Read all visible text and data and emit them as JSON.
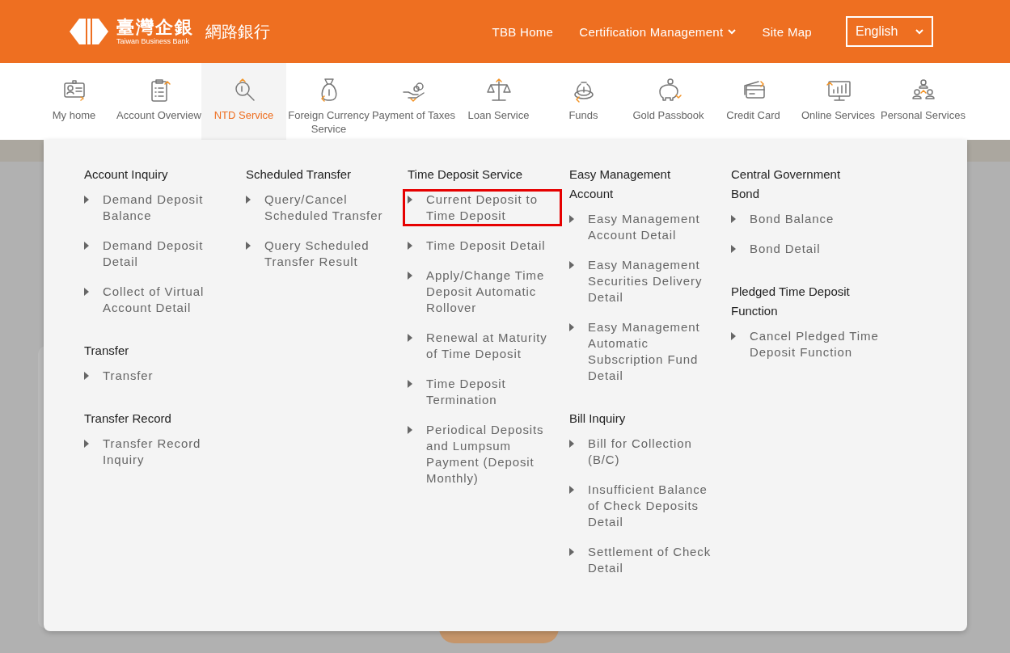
{
  "header": {
    "logo_main": "臺灣企銀",
    "logo_sub": "Taiwan Business Bank",
    "site_title": "網路銀行",
    "links": [
      {
        "label": "TBB Home",
        "dropdown": false
      },
      {
        "label": "Certification Management",
        "dropdown": true
      },
      {
        "label": "Site Map",
        "dropdown": false
      }
    ],
    "language": {
      "value": "English"
    }
  },
  "nav": [
    {
      "label": "My home",
      "selected": false
    },
    {
      "label": "Account Overview",
      "selected": false
    },
    {
      "label": "NTD Service",
      "selected": true
    },
    {
      "label": "Foreign Currency Service",
      "selected": false
    },
    {
      "label": "Payment of Taxes",
      "selected": false
    },
    {
      "label": "Loan Service",
      "selected": false
    },
    {
      "label": "Funds",
      "selected": false
    },
    {
      "label": "Gold Passbook",
      "selected": false
    },
    {
      "label": "Credit Card",
      "selected": false
    },
    {
      "label": "Online Services",
      "selected": false
    },
    {
      "label": "Personal Services",
      "selected": false
    }
  ],
  "menu": {
    "columns": [
      {
        "groups": [
          {
            "title": "Account Inquiry",
            "items": [
              {
                "label": "Demand Deposit Balance",
                "highlighted": false
              },
              {
                "label": "Demand Deposit Detail",
                "highlighted": false
              },
              {
                "label": "Collect of Virtual Account Detail",
                "highlighted": false
              }
            ]
          },
          {
            "title": "Transfer",
            "items": [
              {
                "label": "Transfer",
                "highlighted": false
              }
            ]
          },
          {
            "title": "Transfer Record",
            "items": [
              {
                "label": "Transfer Record Inquiry",
                "highlighted": false
              }
            ]
          }
        ]
      },
      {
        "groups": [
          {
            "title": "Scheduled Transfer",
            "items": [
              {
                "label": "Query/Cancel Scheduled Transfer",
                "highlighted": false
              },
              {
                "label": "Query Scheduled Transfer Result",
                "highlighted": false
              }
            ]
          }
        ]
      },
      {
        "groups": [
          {
            "title": "Time Deposit Service",
            "items": [
              {
                "label": "Current Deposit to Time Deposit",
                "highlighted": true
              },
              {
                "label": "Time Deposit Detail",
                "highlighted": false
              },
              {
                "label": "Apply/Change Time Deposit Automatic Rollover",
                "highlighted": false
              },
              {
                "label": "Renewal at Maturity of Time Deposit",
                "highlighted": false
              },
              {
                "label": "Time Deposit Termination",
                "highlighted": false
              },
              {
                "label": "Periodical Deposits and Lumpsum Payment (Deposit Monthly)",
                "highlighted": false
              }
            ]
          }
        ]
      },
      {
        "groups": [
          {
            "title": "Easy Management Account",
            "items": [
              {
                "label": "Easy Management Account Detail",
                "highlighted": false
              },
              {
                "label": "Easy Management Securities Delivery Detail",
                "highlighted": false
              },
              {
                "label": "Easy Management Automatic Subscription Fund Detail",
                "highlighted": false
              }
            ]
          },
          {
            "title": "Bill Inquiry",
            "items": [
              {
                "label": "Bill for Collection (B/C)",
                "highlighted": false
              },
              {
                "label": "Insufficient Balance of Check Deposits Detail",
                "highlighted": false
              },
              {
                "label": "Settlement of Check Detail",
                "highlighted": false
              }
            ]
          }
        ]
      },
      {
        "groups": [
          {
            "title": "Central Government Bond",
            "items": [
              {
                "label": "Bond Balance",
                "highlighted": false
              },
              {
                "label": "Bond Detail",
                "highlighted": false
              }
            ]
          },
          {
            "title": "Pledged Time Deposit Function",
            "items": [
              {
                "label": "Cancel Pledged Time Deposit Function",
                "highlighted": false
              }
            ]
          }
        ]
      }
    ]
  }
}
